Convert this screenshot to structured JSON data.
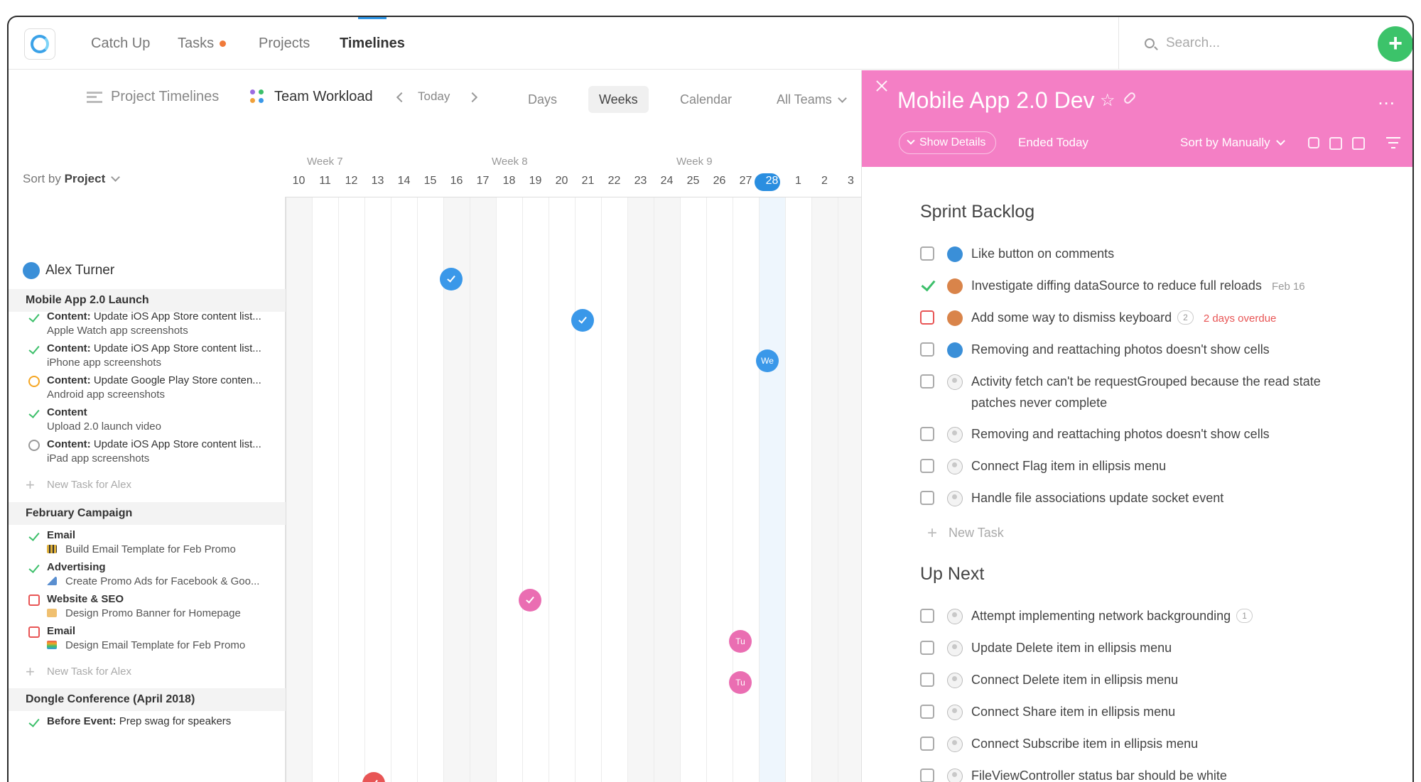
{
  "nav": {
    "tabs": [
      "Catch Up",
      "Tasks",
      "Projects",
      "Timelines"
    ],
    "active_tab": "Timelines",
    "search_placeholder": "Search...",
    "add_label": "+"
  },
  "toolbar": {
    "project_timelines": "Project Timelines",
    "team_workload": "Team Workload",
    "today": "Today",
    "views": [
      "Days",
      "Weeks",
      "Calendar"
    ],
    "selected_view": "Weeks",
    "teams": "All Teams"
  },
  "sort": {
    "prefix": "Sort by",
    "value": "Project"
  },
  "timeline": {
    "weeks": [
      "Week 7",
      "Week 8",
      "Week 9"
    ],
    "days": [
      "10",
      "11",
      "12",
      "13",
      "14",
      "15",
      "16",
      "17",
      "18",
      "19",
      "20",
      "21",
      "22",
      "23",
      "24",
      "25",
      "26",
      "27",
      "28",
      "1",
      "2",
      "3"
    ],
    "today": "28"
  },
  "person": {
    "name": "Alex Turner"
  },
  "groups": [
    {
      "name": "Mobile App 2.0 Launch",
      "tasks": [
        {
          "status": "done",
          "label": "Content:",
          "title": "Update iOS App Store content list...",
          "sub": "Apple Watch app screenshots"
        },
        {
          "status": "done",
          "label": "Content:",
          "title": "Update iOS App Store content list...",
          "sub": "iPhone app screenshots"
        },
        {
          "status": "progress",
          "label": "Content:",
          "title": "Update Google Play Store conten...",
          "sub": "Android app screenshots"
        },
        {
          "status": "done",
          "label": "Content",
          "title": "",
          "sub": "Upload 2.0 launch video"
        },
        {
          "status": "open",
          "label": "Content:",
          "title": "Update iOS App Store content list...",
          "sub": "iPad app screenshots"
        }
      ],
      "new_task": "New Task for Alex"
    },
    {
      "name": "February Campaign",
      "tasks": [
        {
          "status": "done",
          "label": "Email",
          "title": "",
          "sub": "Build Email Template for Feb Promo"
        },
        {
          "status": "done",
          "label": "Advertising",
          "title": "",
          "sub": "Create Promo Ads for Facebook & Goo..."
        },
        {
          "status": "todo",
          "label": "Website & SEO",
          "title": "",
          "sub": "Design Promo Banner for Homepage"
        },
        {
          "status": "todo",
          "label": "Email",
          "title": "",
          "sub": "Design Email Template for Feb Promo"
        }
      ],
      "new_task": "New Task for Alex"
    },
    {
      "name": "Dongle Conference (April 2018)",
      "tasks": [
        {
          "status": "done",
          "label": "Before Event:",
          "title": "Prep swag for speakers",
          "sub": ""
        }
      ]
    }
  ],
  "markers": [
    "We",
    "Tu",
    "Tu"
  ],
  "panel": {
    "title": "Mobile App 2.0 Dev",
    "show_details": "Show Details",
    "status": "Ended Today",
    "sort": "Sort by Manually",
    "more": "...",
    "sections": [
      {
        "name": "Sprint Backlog",
        "tasks": [
          {
            "text": "Like button on comments",
            "state": "open",
            "meta": ""
          },
          {
            "text": "Investigate diffing dataSource to reduce full reloads",
            "state": "done",
            "meta": "Feb 16"
          },
          {
            "text": "Add some way to dismiss keyboard",
            "state": "overdue",
            "count": "2",
            "meta": "2 days overdue"
          },
          {
            "text": "Removing and reattaching photos doesn't show cells",
            "state": "open",
            "meta": ""
          },
          {
            "text": "Activity fetch can't be requestGrouped because the read state",
            "text2": "patches never complete",
            "state": "open",
            "meta": ""
          },
          {
            "text": "Removing and reattaching photos doesn't show cells",
            "state": "open",
            "meta": ""
          },
          {
            "text": "Connect Flag item in ellipsis menu",
            "state": "open",
            "meta": ""
          },
          {
            "text": "Handle file associations update socket event",
            "state": "open",
            "meta": ""
          }
        ],
        "new_task": "New Task"
      },
      {
        "name": "Up Next",
        "tasks": [
          {
            "text": "Attempt implementing network backgrounding",
            "state": "open",
            "count": "1",
            "meta": ""
          },
          {
            "text": "Update Delete item in ellipsis menu",
            "state": "open",
            "meta": ""
          },
          {
            "text": "Connect Delete item in ellipsis menu",
            "state": "open",
            "meta": ""
          },
          {
            "text": "Connect Share item in ellipsis menu",
            "state": "open",
            "meta": ""
          },
          {
            "text": "Connect Subscribe item in ellipsis menu",
            "state": "open",
            "meta": ""
          },
          {
            "text": "FileViewController status bar should be white",
            "state": "open",
            "meta": ""
          }
        ]
      }
    ]
  },
  "colors": {
    "accent": "#2a8ee0",
    "panel_header": "#f47fc5",
    "add_button": "#3cc36a",
    "overdue": "#e85555"
  }
}
